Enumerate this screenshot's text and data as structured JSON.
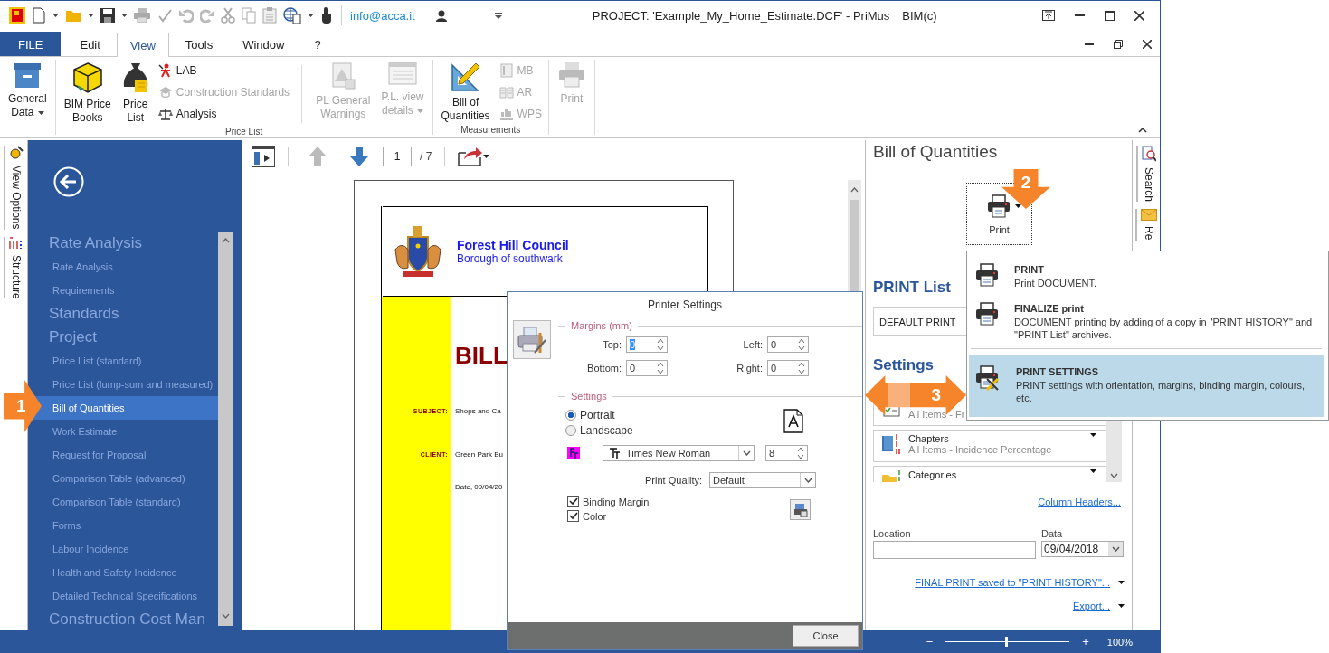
{
  "window": {
    "title": "PROJECT: 'Example_My_Home_Estimate.DCF' - PriMus",
    "edition": "BIM(c)"
  },
  "quick_access": {
    "account": "info@acca.it"
  },
  "menu_tabs": [
    {
      "label": "FILE",
      "kind": "file",
      "selected": false
    },
    {
      "label": "Edit",
      "kind": "tab",
      "selected": false
    },
    {
      "label": "View",
      "kind": "tab",
      "selected": true
    },
    {
      "label": "Tools",
      "kind": "tab",
      "selected": false
    },
    {
      "label": "Window",
      "kind": "tab",
      "selected": false
    },
    {
      "label": "?",
      "kind": "tab",
      "selected": false
    }
  ],
  "ribbon": {
    "groups": [
      {
        "buttons": [
          {
            "label": "General\nData",
            "kind": "large",
            "disabled": false,
            "dropdown": true
          }
        ]
      },
      {
        "label": "Price List",
        "buttons": [
          {
            "label": "BIM Price\nBooks",
            "kind": "large",
            "disabled": false,
            "dropdown": false
          },
          {
            "label": "Price\nList",
            "kind": "large",
            "disabled": false,
            "dropdown": false
          },
          {
            "label": "LAB",
            "kind": "small",
            "disabled": false
          },
          {
            "label": "Construction Standards",
            "kind": "small",
            "disabled": true
          },
          {
            "label": "Analysis",
            "kind": "small",
            "disabled": false
          },
          {
            "label": "PL General\nWarnings",
            "kind": "large",
            "disabled": true,
            "dropdown": false
          },
          {
            "label": "P.L. view\ndetails",
            "kind": "large",
            "disabled": true,
            "dropdown": true
          }
        ]
      },
      {
        "label": "Measurements",
        "buttons": [
          {
            "label": "Bill of\nQuantities",
            "kind": "large",
            "disabled": false,
            "dropdown": false
          },
          {
            "label": "MB",
            "kind": "small",
            "disabled": true
          },
          {
            "label": "AR",
            "kind": "small",
            "disabled": true
          },
          {
            "label": "WPS",
            "kind": "small",
            "disabled": true
          }
        ]
      },
      {
        "buttons": [
          {
            "label": "Print",
            "kind": "large",
            "disabled": true,
            "dropdown": false
          }
        ]
      }
    ]
  },
  "side_tabs": [
    {
      "label": "View Options"
    },
    {
      "label": "Structure"
    }
  ],
  "navigation": {
    "items": [
      {
        "label": "Rate Analysis",
        "kind": "heading",
        "selected": false
      },
      {
        "label": "Rate Analysis",
        "kind": "item",
        "selected": false
      },
      {
        "label": "Requirements",
        "kind": "item",
        "selected": false
      },
      {
        "label": "Standards",
        "kind": "heading",
        "selected": false
      },
      {
        "label": "Project",
        "kind": "heading",
        "selected": false
      },
      {
        "label": "Price List (standard)",
        "kind": "item",
        "selected": false
      },
      {
        "label": "Price List (lump-sum and measured)",
        "kind": "item",
        "selected": false
      },
      {
        "label": "Bill of Quantities",
        "kind": "item",
        "selected": true
      },
      {
        "label": "Work Estimate",
        "kind": "item",
        "selected": false
      },
      {
        "label": "Request for Proposal",
        "kind": "item",
        "selected": false
      },
      {
        "label": "Comparison Table (advanced)",
        "kind": "item",
        "selected": false
      },
      {
        "label": "Comparison Table (standard)",
        "kind": "item",
        "selected": false
      },
      {
        "label": "Forms",
        "kind": "item",
        "selected": false
      },
      {
        "label": "Labour Incidence",
        "kind": "item",
        "selected": false
      },
      {
        "label": "Health and Safety Incidence",
        "kind": "item",
        "selected": false
      },
      {
        "label": "Detailed Technical Specifications",
        "kind": "item",
        "selected": false
      },
      {
        "label": "Construction Cost Man",
        "kind": "heading",
        "selected": false
      }
    ]
  },
  "preview_toolbar": {
    "page": "1",
    "total": "/ 7"
  },
  "document": {
    "council": "Forest Hill Council",
    "borough": "Borough of southwark",
    "title": "BILL",
    "fields": [
      {
        "label": "SUBJECT:",
        "value": "Shops and Ca"
      },
      {
        "label": "CLIENT:",
        "value": "Green Park Bu"
      }
    ],
    "date": "Date, 09/04/20"
  },
  "printer_dialog": {
    "title": "Printer Settings",
    "margins_title": "Margins (mm)",
    "margins": [
      {
        "label": "Top:",
        "value": "0"
      },
      {
        "label": "Left:",
        "value": "0"
      },
      {
        "label": "Bottom:",
        "value": "0"
      },
      {
        "label": "Right:",
        "value": "0"
      }
    ],
    "settings_title": "Settings",
    "orientation": [
      {
        "label": "Portrait",
        "selected": true
      },
      {
        "label": "Landscape",
        "selected": false
      }
    ],
    "font": "Times New Roman",
    "font_size": "8",
    "quality_label": "Print Quality:",
    "quality": "Default",
    "options": [
      {
        "label": "Binding Margin",
        "checked": true
      },
      {
        "label": "Color",
        "checked": true
      }
    ],
    "close": "Close"
  },
  "bill_panel": {
    "title": "Bill of Quantities",
    "print_button": "Print",
    "list_title": "PRINT List",
    "default_print": "DEFAULT PRINT",
    "settings_title": "Settings",
    "settings_items": [
      {
        "subtitle": "All Items - Fr"
      },
      {
        "title": "Chapters",
        "subtitle": "All Items - Incidence Percentage"
      },
      {
        "title": "Categories"
      }
    ],
    "column_headers": "Column Headers...",
    "location_label": "Location",
    "date_label": "Data",
    "date": "09/04/2018",
    "final_print": "FINAL PRINT saved to \"PRINT HISTORY\"...",
    "export": "Export..."
  },
  "right_tabs": [
    {
      "label": "Search"
    },
    {
      "label": "Re"
    }
  ],
  "print_menu": {
    "items": [
      {
        "title": "PRINT",
        "description": "Print DOCUMENT.",
        "selected": false
      },
      {
        "title": "FINALIZE print",
        "description": "DOCUMENT printing by adding of a copy in \"PRINT HISTORY\" and \"PRINT List\" archives.",
        "selected": false
      },
      {
        "title": "PRINT SETTINGS",
        "description": "PRINT settings with orientation, margins, binding margin, colours, etc.",
        "selected": true
      }
    ]
  },
  "status_bar": {
    "minus": "−",
    "plus": "+",
    "zoom": "100%",
    "level": 0.49
  },
  "callouts": [
    {
      "number": "1",
      "kind": "right"
    },
    {
      "number": "2",
      "kind": "down"
    },
    {
      "number": "3",
      "kind": "both"
    }
  ]
}
